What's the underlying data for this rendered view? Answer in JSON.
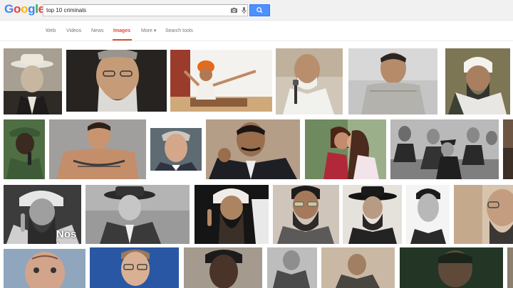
{
  "header": {
    "logo": [
      "G",
      "o",
      "o",
      "g",
      "l",
      "e"
    ],
    "logo_colors": [
      "#4285f4",
      "#ea4335",
      "#fbbc05",
      "#4285f4",
      "#34a853",
      "#ea4335"
    ],
    "search_query": "top 10 criminals"
  },
  "nav": {
    "web": "Web",
    "videos": "Videos",
    "news": "News",
    "images": "Images",
    "more": "More ▾",
    "search_tools": "Search tools",
    "active_color": "#dd4b39"
  },
  "results": {
    "overlay_caption": "Nos I"
  }
}
